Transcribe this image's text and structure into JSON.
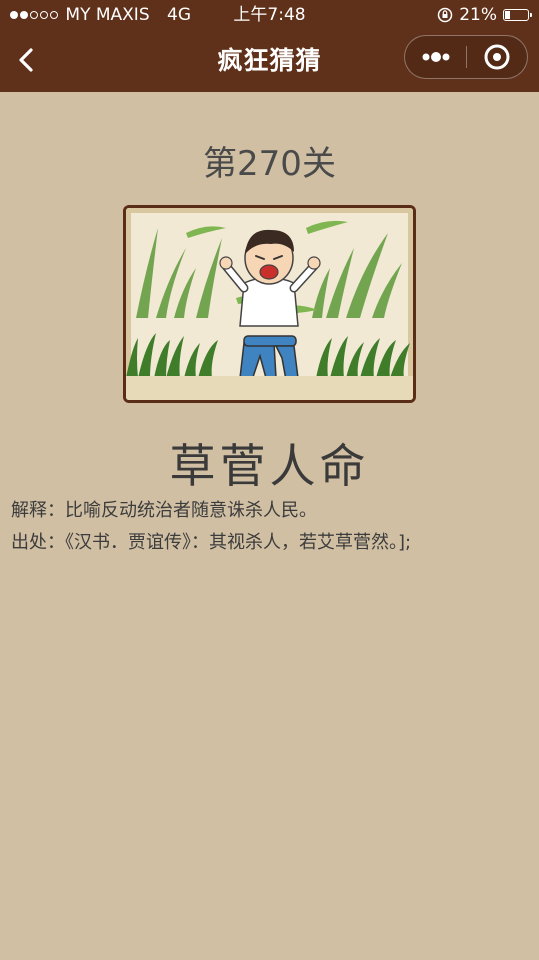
{
  "status_bar": {
    "carrier": "MY MAXIS",
    "network": "4G",
    "time": "上午7:48",
    "battery": "21%"
  },
  "nav": {
    "title": "疯狂猜猜",
    "icons": [
      "back-chevron-icon",
      "more-dots-icon",
      "close-target-icon"
    ]
  },
  "level": {
    "label": "第270关"
  },
  "answer": {
    "idiom": "草菅人命",
    "explanation_label": "解释：",
    "explanation": "比喻反动统治者随意诛杀人民。",
    "source_label": "出处：",
    "source": "《汉书．贾谊传》：其视杀人，若艾草菅然。];"
  },
  "colors": {
    "nav_bg": "#5f301a",
    "page_bg": "#d0bfa3",
    "text": "#3a3a3a"
  }
}
